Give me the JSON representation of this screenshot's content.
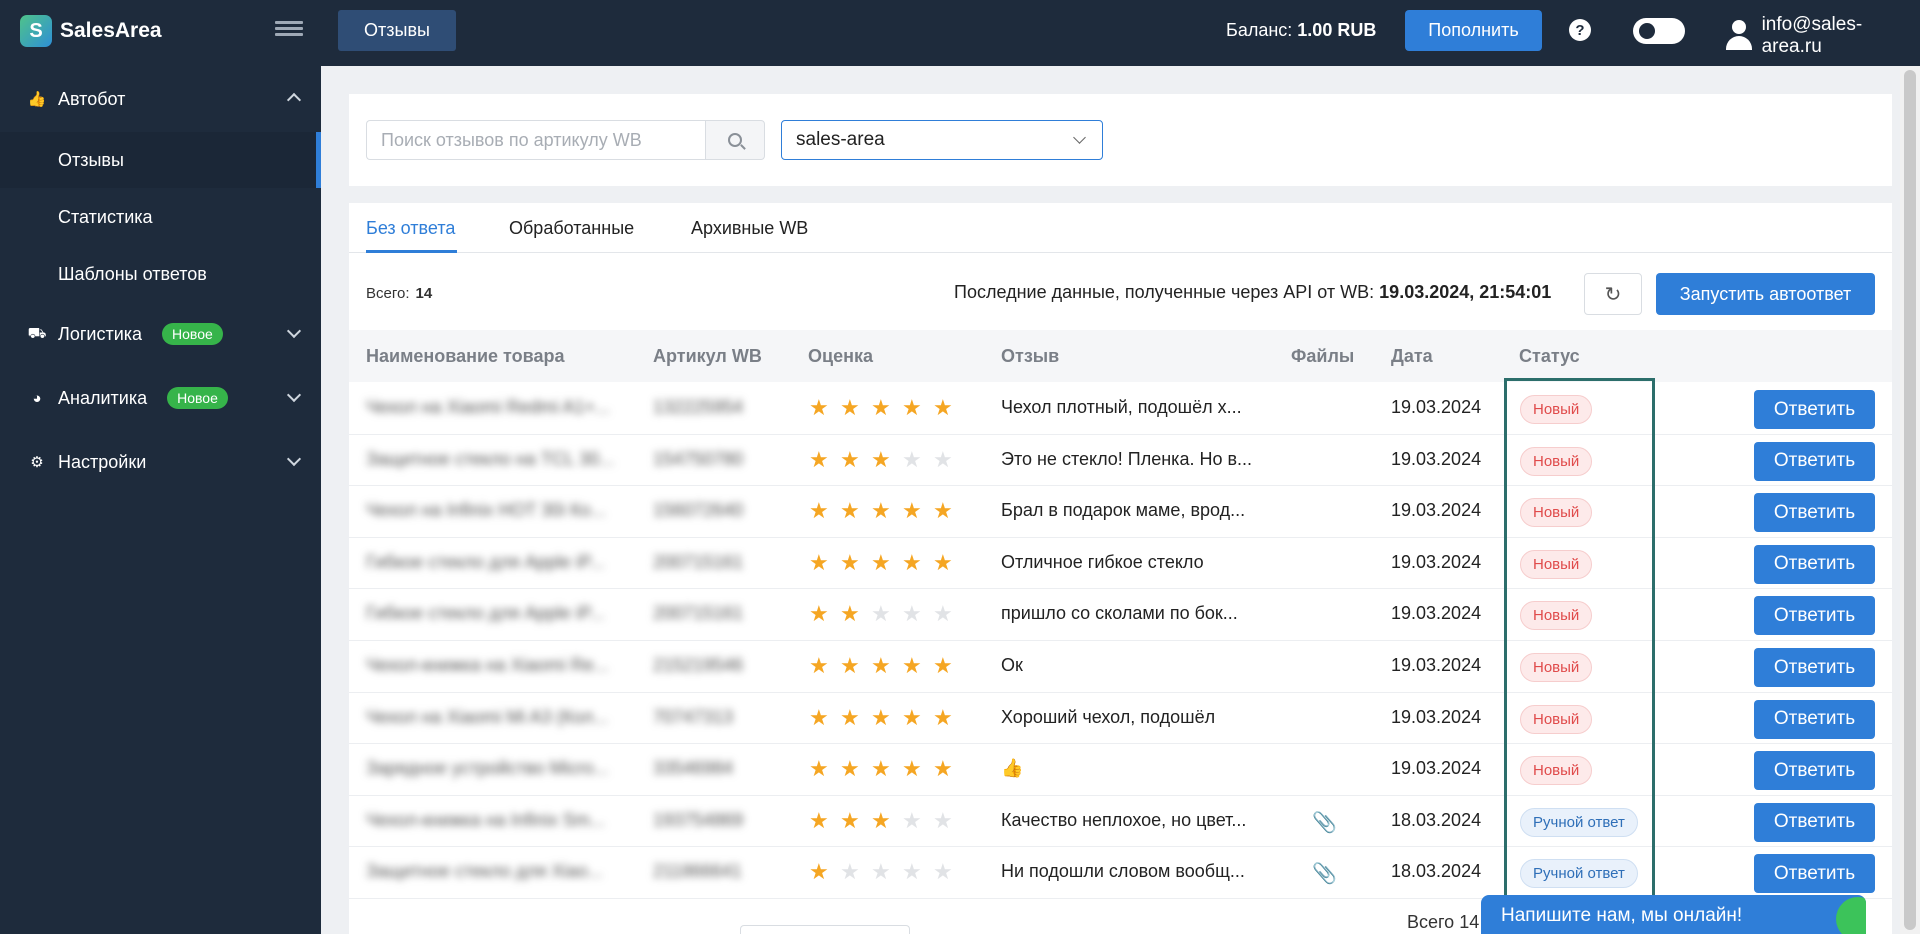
{
  "app": {
    "name": "SalesArea"
  },
  "sidebar": {
    "groups": [
      {
        "label": "Автобот",
        "icon": "thumbs-up-icon",
        "badge": null,
        "expanded": true
      },
      {
        "label": "Логистика",
        "icon": "truck-icon",
        "badge": "Новое",
        "expanded": false
      },
      {
        "label": "Аналитика",
        "icon": "pie-chart-icon",
        "badge": "Новое",
        "expanded": false
      },
      {
        "label": "Настройки",
        "icon": "gear-icon",
        "badge": null,
        "expanded": false
      }
    ],
    "subitems": [
      "Отзывы",
      "Статистика",
      "Шаблоны ответов"
    ],
    "active_subitem": "Отзывы"
  },
  "header": {
    "tab": "Отзывы",
    "balance_label": "Баланс:",
    "balance_value": "1.00 RUB",
    "topup_label": "Пополнить",
    "help_icon": "?",
    "user_email": "info@sales-area.ru"
  },
  "search": {
    "placeholder": "Поиск отзывов по артикулу WB",
    "value": "",
    "shop_selected": "sales-area"
  },
  "tabs": [
    "Без ответа",
    "Обработанные",
    "Архивные WB"
  ],
  "active_tab": "Без ответа",
  "summary": {
    "total_label": "Всего:",
    "total_value": "14",
    "lastdata_label": "Последние данные, полученные через API от WB:",
    "lastdata_value": "19.03.2024, 21:54:01",
    "autoreply_label": "Запустить автоответ"
  },
  "table": {
    "columns": [
      "Наименование товара",
      "Артикул WB",
      "Оценка",
      "Отзыв",
      "Файлы",
      "Дата",
      "Статус"
    ],
    "rows": [
      {
        "product": "Чехол на Xiaomi Redmi A1+...",
        "article": "132225954",
        "rating": 5,
        "review": "Чехол плотный, подошёл х...",
        "files": false,
        "date": "19.03.2024",
        "status": "Новый",
        "status_type": "new",
        "action": "Ответить"
      },
      {
        "product": "Защитное стекло на TCL 30...",
        "article": "154750780",
        "rating": 3,
        "review": "Это не стекло! Пленка. Но в...",
        "files": false,
        "date": "19.03.2024",
        "status": "Новый",
        "status_type": "new",
        "action": "Ответить"
      },
      {
        "product": "Чехол на Infinix HOT 30i Ко...",
        "article": "156072640",
        "rating": 5,
        "review": "Брал в подарок маме, врод...",
        "files": false,
        "date": "19.03.2024",
        "status": "Новый",
        "status_type": "new",
        "action": "Ответить"
      },
      {
        "product": "Гибкое стекло для Apple iP...",
        "article": "200715161",
        "rating": 5,
        "review": "Отличное гибкое стекло",
        "files": false,
        "date": "19.03.2024",
        "status": "Новый",
        "status_type": "new",
        "action": "Ответить"
      },
      {
        "product": "Гибкое стекло для Apple iP...",
        "article": "200715161",
        "rating": 2,
        "review": "пришло со сколами по бок...",
        "files": false,
        "date": "19.03.2024",
        "status": "Новый",
        "status_type": "new",
        "action": "Ответить"
      },
      {
        "product": "Чехол-книжка на Xiaomi Re...",
        "article": "215219546",
        "rating": 5,
        "review": "Ок",
        "files": false,
        "date": "19.03.2024",
        "status": "Новый",
        "status_type": "new",
        "action": "Ответить"
      },
      {
        "product": "Чехол на Xiaomi Mi A3 (Кол...",
        "article": "70747313",
        "rating": 5,
        "review": "Хороший чехол, подошёл",
        "files": false,
        "date": "19.03.2024",
        "status": "Новый",
        "status_type": "new",
        "action": "Ответить"
      },
      {
        "product": "Зарядное устройство Micro...",
        "article": "33546984",
        "rating": 5,
        "review": "👍",
        "files": false,
        "date": "19.03.2024",
        "status": "Новый",
        "status_type": "new",
        "action": "Ответить"
      },
      {
        "product": "Чехол-книжка на Infinix Sm...",
        "article": "193754869",
        "rating": 3,
        "review": "Качество неплохое, но цвет...",
        "files": true,
        "date": "18.03.2024",
        "status": "Ручной ответ",
        "status_type": "manual",
        "action": "Ответить"
      },
      {
        "product": "Защитное стекло для Xiao...",
        "article": "211866641",
        "rating": 1,
        "review": "Ни подошли словом вообщ...",
        "files": true,
        "date": "18.03.2024",
        "status": "Ручной ответ",
        "status_type": "manual",
        "action": "Ответить"
      }
    ]
  },
  "footer": {
    "total_text": "Всего 14"
  },
  "chat": {
    "label": "Напишите нам, мы онлайн!"
  },
  "colors": {
    "sidebar_bg": "#1e2b3c",
    "accent": "#2f7ed8",
    "badge_green": "#36b44a",
    "star": "#f5a623"
  }
}
